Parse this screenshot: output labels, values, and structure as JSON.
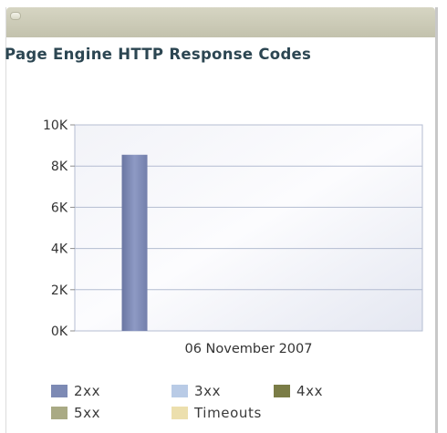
{
  "chart_data": {
    "type": "bar",
    "title": "Page Engine HTTP Response Codes",
    "xlabel": "",
    "ylabel": "",
    "categories": [
      "06 November 2007"
    ],
    "yticks": [
      "0K",
      "2K",
      "4K",
      "6K",
      "8K",
      "10K"
    ],
    "ylim": [
      0,
      10000
    ],
    "grid": true,
    "legend_position": "bottom",
    "series": [
      {
        "name": "2xx",
        "values": [
          8550
        ],
        "color": "#7d8ab4"
      },
      {
        "name": "3xx",
        "values": [
          0
        ],
        "color": "#b9cbe6"
      },
      {
        "name": "4xx",
        "values": [
          0
        ],
        "color": "#7a7c46"
      },
      {
        "name": "5xx",
        "values": [
          0
        ],
        "color": "#a9aa84"
      },
      {
        "name": "Timeouts",
        "values": [
          0
        ],
        "color": "#ecdfad"
      }
    ]
  }
}
